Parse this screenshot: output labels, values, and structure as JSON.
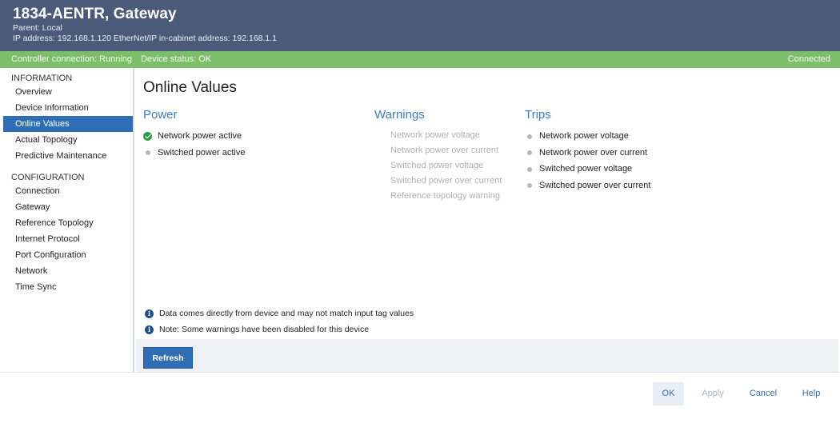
{
  "header": {
    "title": "1834-AENTR, Gateway",
    "parent": "Parent: Local",
    "address": "IP address: 192.168.1.120  EtherNet/IP in-cabinet address: 192.168.1.1"
  },
  "status": {
    "controller": "Controller connection: Running",
    "device": "Device status: OK",
    "connected": "Connected",
    "color": "#7dbe6a"
  },
  "sidebar": {
    "information_label": "INFORMATION",
    "information_items": [
      "Overview",
      "Device Information",
      "Online Values",
      "Actual Topology",
      "Predictive Maintenance"
    ],
    "configuration_label": "CONFIGURATION",
    "configuration_items": [
      "Connection",
      "Gateway",
      "Reference Topology",
      "Internet Protocol",
      "Port Configuration",
      "Network",
      "Time Sync"
    ],
    "active": "Online Values"
  },
  "main": {
    "title": "Online Values",
    "power": {
      "heading": "Power",
      "items": [
        {
          "label": "Network power active",
          "state": "active",
          "icon": "check-icon"
        },
        {
          "label": "Switched power active",
          "state": "inactive",
          "icon": "dot-icon"
        }
      ]
    },
    "warnings": {
      "heading": "Warnings",
      "items": [
        "Network power voltage",
        "Network power over current",
        "Switched power voltage",
        "Switched power over current",
        "Reference topology warning"
      ]
    },
    "trips": {
      "heading": "Trips",
      "items": [
        "Network power voltage",
        "Network power over current",
        "Switched power voltage",
        "Switched power over current"
      ]
    },
    "notes": [
      "Data comes directly from device and may not match input tag values",
      "Note: Some warnings have been disabled for this device"
    ],
    "refresh_label": "Refresh"
  },
  "footer": {
    "ok": "OK",
    "apply": "Apply",
    "cancel": "Cancel",
    "help": "Help"
  },
  "colors": {
    "header": "#4a5a78",
    "accent": "#2f6eb5",
    "heading": "#3b7dc4",
    "ok_green": "#2e9b45"
  }
}
